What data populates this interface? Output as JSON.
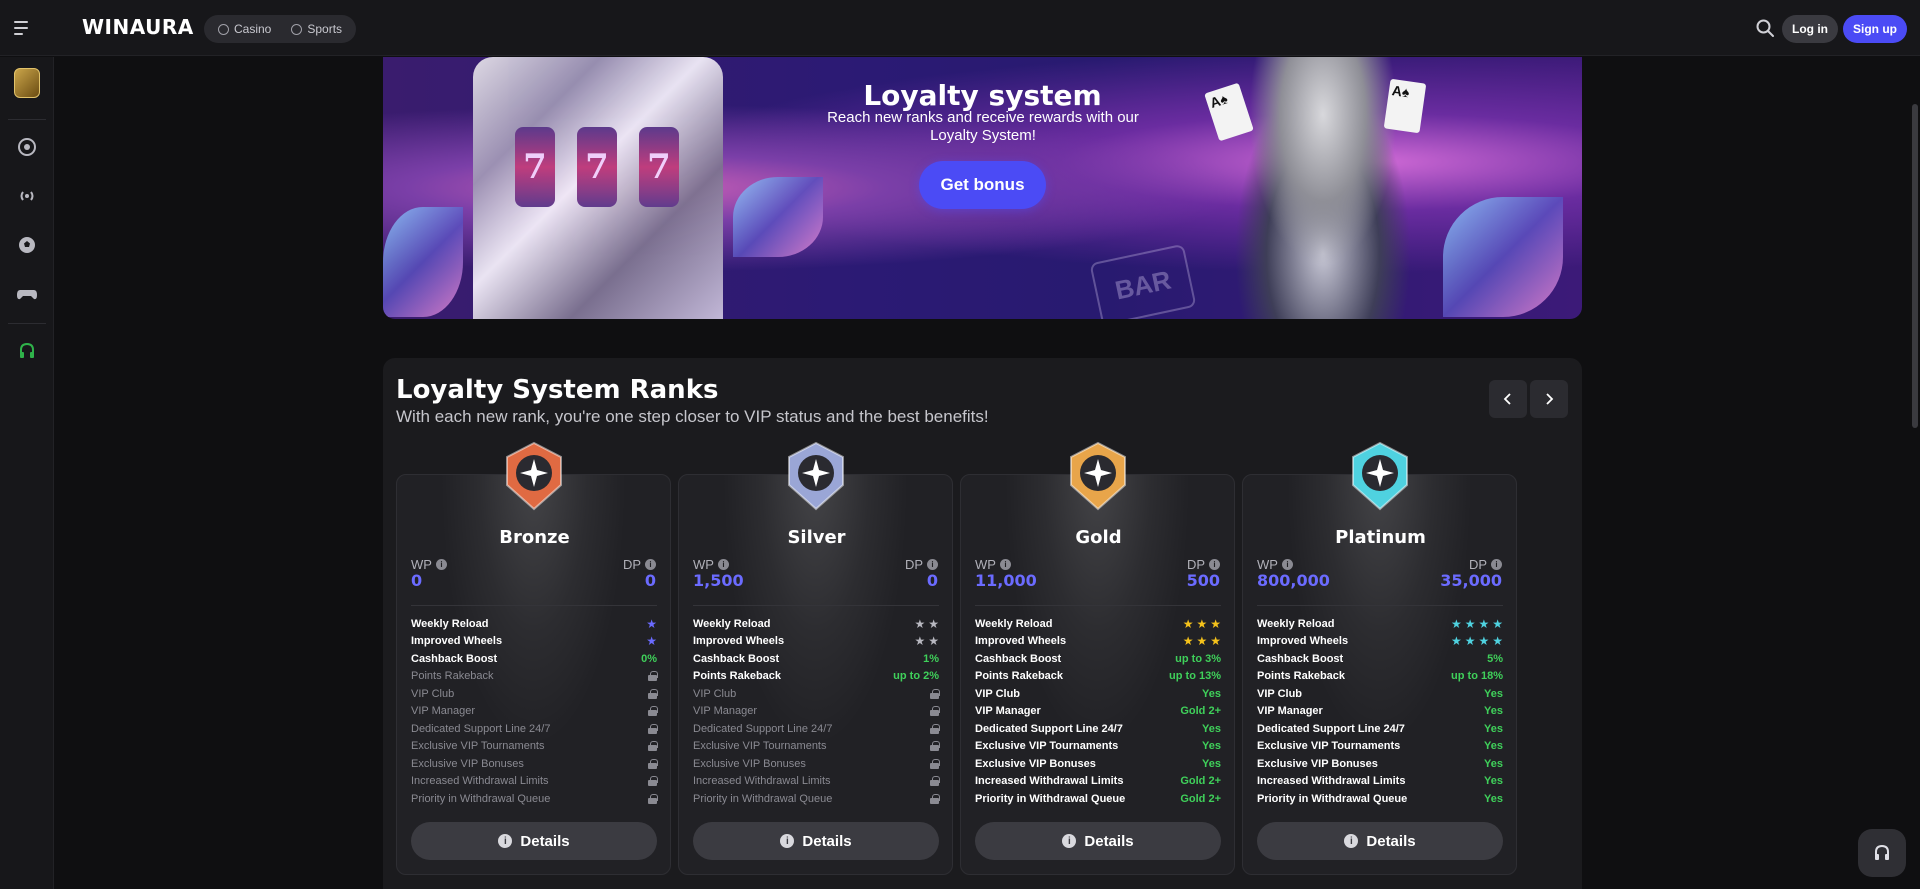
{
  "header": {
    "logo": "WINAURA",
    "modes": [
      {
        "label": "Casino"
      },
      {
        "label": "Sports"
      }
    ],
    "login_label": "Log in",
    "signup_label": "Sign up"
  },
  "banner": {
    "title": "Loyalty system",
    "subtitle": "Reach new ranks and receive rewards with our Loyalty System!",
    "button_label": "Get bonus",
    "sign_text": "BAR"
  },
  "ranks": {
    "title": "Loyalty System Ranks",
    "subtitle": "With each new rank, you're one step closer to VIP status and the best benefits!",
    "wp_label": "WP",
    "dp_label": "DP",
    "details_label": "Details",
    "cards": [
      {
        "name": "Bronze",
        "wp": "0",
        "dp": "0",
        "badge_color": "#e06a42",
        "star_count": 1,
        "star_color": "#6b6bff",
        "features": [
          {
            "name": "Weekly Reload",
            "type": "stars"
          },
          {
            "name": "Improved Wheels",
            "type": "stars"
          },
          {
            "name": "Cashback Boost",
            "value": "0%"
          },
          {
            "name": "Points Rakeback",
            "locked": true
          },
          {
            "name": "VIP Club",
            "locked": true
          },
          {
            "name": "VIP Manager",
            "locked": true
          },
          {
            "name": "Dedicated Support Line 24/7",
            "locked": true
          },
          {
            "name": "Exclusive VIP Tournaments",
            "locked": true
          },
          {
            "name": "Exclusive VIP Bonuses",
            "locked": true
          },
          {
            "name": "Increased Withdrawal Limits",
            "locked": true
          },
          {
            "name": "Priority in Withdrawal Queue",
            "locked": true
          }
        ]
      },
      {
        "name": "Silver",
        "wp": "1,500",
        "dp": "0",
        "badge_color": "#9aa6d6",
        "star_count": 2,
        "star_color": "#b8b8c0",
        "features": [
          {
            "name": "Weekly Reload",
            "type": "stars"
          },
          {
            "name": "Improved Wheels",
            "type": "stars"
          },
          {
            "name": "Cashback Boost",
            "value": "1%"
          },
          {
            "name": "Points Rakeback",
            "value": "up to 2%"
          },
          {
            "name": "VIP Club",
            "locked": true
          },
          {
            "name": "VIP Manager",
            "locked": true
          },
          {
            "name": "Dedicated Support Line 24/7",
            "locked": true
          },
          {
            "name": "Exclusive VIP Tournaments",
            "locked": true
          },
          {
            "name": "Exclusive VIP Bonuses",
            "locked": true
          },
          {
            "name": "Increased Withdrawal Limits",
            "locked": true
          },
          {
            "name": "Priority in Withdrawal Queue",
            "locked": true
          }
        ]
      },
      {
        "name": "Gold",
        "wp": "11,000",
        "dp": "500",
        "badge_color": "#e8a54a",
        "star_count": 3,
        "star_color": "#f5c21b",
        "features": [
          {
            "name": "Weekly Reload",
            "type": "stars"
          },
          {
            "name": "Improved Wheels",
            "type": "stars"
          },
          {
            "name": "Cashback Boost",
            "value": "up to 3%"
          },
          {
            "name": "Points Rakeback",
            "value": "up to 13%"
          },
          {
            "name": "VIP Club",
            "value": "Yes"
          },
          {
            "name": "VIP Manager",
            "value": "Gold 2+"
          },
          {
            "name": "Dedicated Support Line 24/7",
            "value": "Yes"
          },
          {
            "name": "Exclusive VIP Tournaments",
            "value": "Yes"
          },
          {
            "name": "Exclusive VIP Bonuses",
            "value": "Yes"
          },
          {
            "name": "Increased Withdrawal Limits",
            "value": "Gold 2+"
          },
          {
            "name": "Priority in Withdrawal Queue",
            "value": "Gold 2+"
          }
        ]
      },
      {
        "name": "Platinum",
        "wp": "800,000",
        "dp": "35,000",
        "badge_color": "#4fd2e0",
        "star_count": 4,
        "star_color": "#4fd2e0",
        "features": [
          {
            "name": "Weekly Reload",
            "type": "stars"
          },
          {
            "name": "Improved Wheels",
            "type": "stars"
          },
          {
            "name": "Cashback Boost",
            "value": "5%"
          },
          {
            "name": "Points Rakeback",
            "value": "up to 18%"
          },
          {
            "name": "VIP Club",
            "value": "Yes"
          },
          {
            "name": "VIP Manager",
            "value": "Yes"
          },
          {
            "name": "Dedicated Support Line 24/7",
            "value": "Yes"
          },
          {
            "name": "Exclusive VIP Tournaments",
            "value": "Yes"
          },
          {
            "name": "Exclusive VIP Bonuses",
            "value": "Yes"
          },
          {
            "name": "Increased Withdrawal Limits",
            "value": "Yes"
          },
          {
            "name": "Priority in Withdrawal Queue",
            "value": "Yes"
          }
        ]
      }
    ]
  },
  "colors": {
    "accent": "#4b4bf5",
    "value_green": "#3fd05a",
    "points_blue": "#6b6bff"
  }
}
